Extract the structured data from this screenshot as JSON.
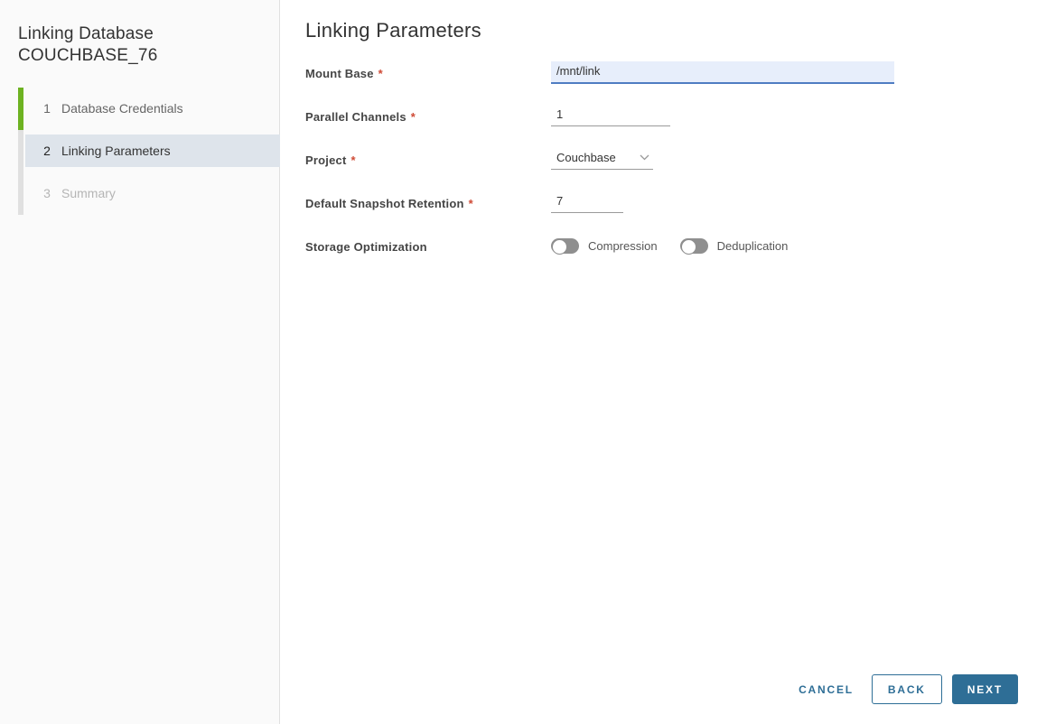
{
  "colors": {
    "accent_blue": "#2e6e96",
    "completed_step_green": "#6db221",
    "active_step_bg": "#dee4eb",
    "focused_input_bg": "#e7eefb",
    "focused_input_border": "#4f7dc2",
    "required_red": "#cf4a35",
    "toggle_off_gray": "#8f8f8f"
  },
  "sidebar": {
    "title_line1": "Linking Database",
    "title_line2": "COUCHBASE_76",
    "steps": [
      {
        "number": "1",
        "label": "Database Credentials",
        "state": "completed"
      },
      {
        "number": "2",
        "label": "Linking Parameters",
        "state": "active"
      },
      {
        "number": "3",
        "label": "Summary",
        "state": "upcoming"
      }
    ]
  },
  "main": {
    "heading": "Linking Parameters",
    "fields": {
      "mount_base": {
        "label": "Mount Base",
        "required": "*",
        "value": "/mnt/link"
      },
      "parallel_channels": {
        "label": "Parallel Channels",
        "required": "*",
        "value": "1"
      },
      "project": {
        "label": "Project",
        "required": "*",
        "value": "Couchbase"
      },
      "snapshot_retention": {
        "label": "Default Snapshot Retention",
        "required": "*",
        "value": "7"
      },
      "storage_optimization": {
        "label": "Storage Optimization",
        "toggles": [
          {
            "label": "Compression",
            "on": false
          },
          {
            "label": "Deduplication",
            "on": false
          }
        ]
      }
    }
  },
  "footer": {
    "cancel_label": "CANCEL",
    "back_label": "BACK",
    "next_label": "NEXT"
  }
}
